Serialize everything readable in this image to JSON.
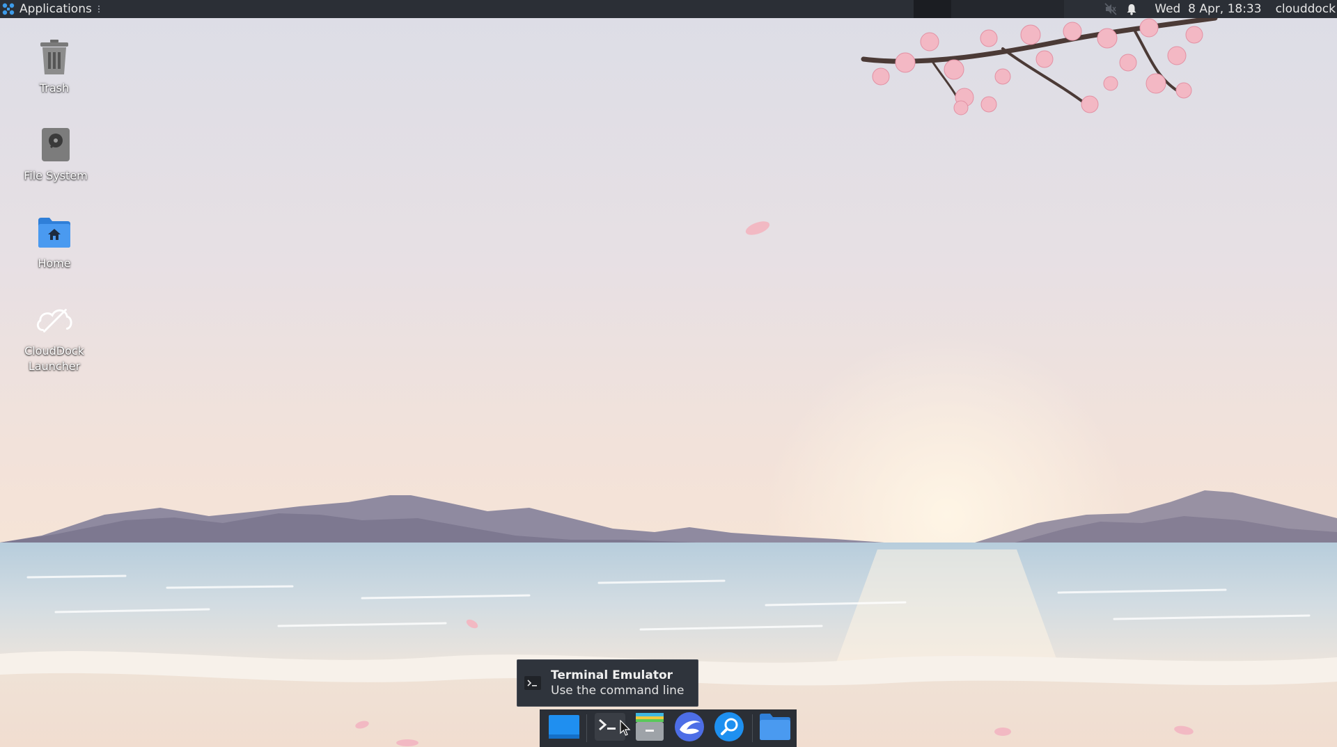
{
  "top_panel": {
    "applications_label": "Applications",
    "clock": "Wed  8 Apr, 18:33",
    "user": "clouddock",
    "icons": [
      "applications-logo-icon",
      "muted-speaker-icon",
      "notification-bell-icon"
    ]
  },
  "desktop": {
    "icons": [
      {
        "label": "Trash",
        "icon": "trash-icon"
      },
      {
        "label": "File System",
        "icon": "drive-icon"
      },
      {
        "label": "Home",
        "icon": "home-folder-icon"
      },
      {
        "label": "CloudDock\nLauncher",
        "icon": "clouddock-icon"
      }
    ]
  },
  "tooltip": {
    "title": "Terminal Emulator",
    "subtitle": "Use the command line",
    "icon": "terminal-icon"
  },
  "dock": {
    "items": [
      "show-desktop-icon",
      "terminal-icon",
      "file-manager-icon",
      "web-browser-icon",
      "app-finder-icon",
      "folder-icon"
    ]
  },
  "colors": {
    "panel": "#2b2f36",
    "accent_blue": "#3d8fe0"
  }
}
